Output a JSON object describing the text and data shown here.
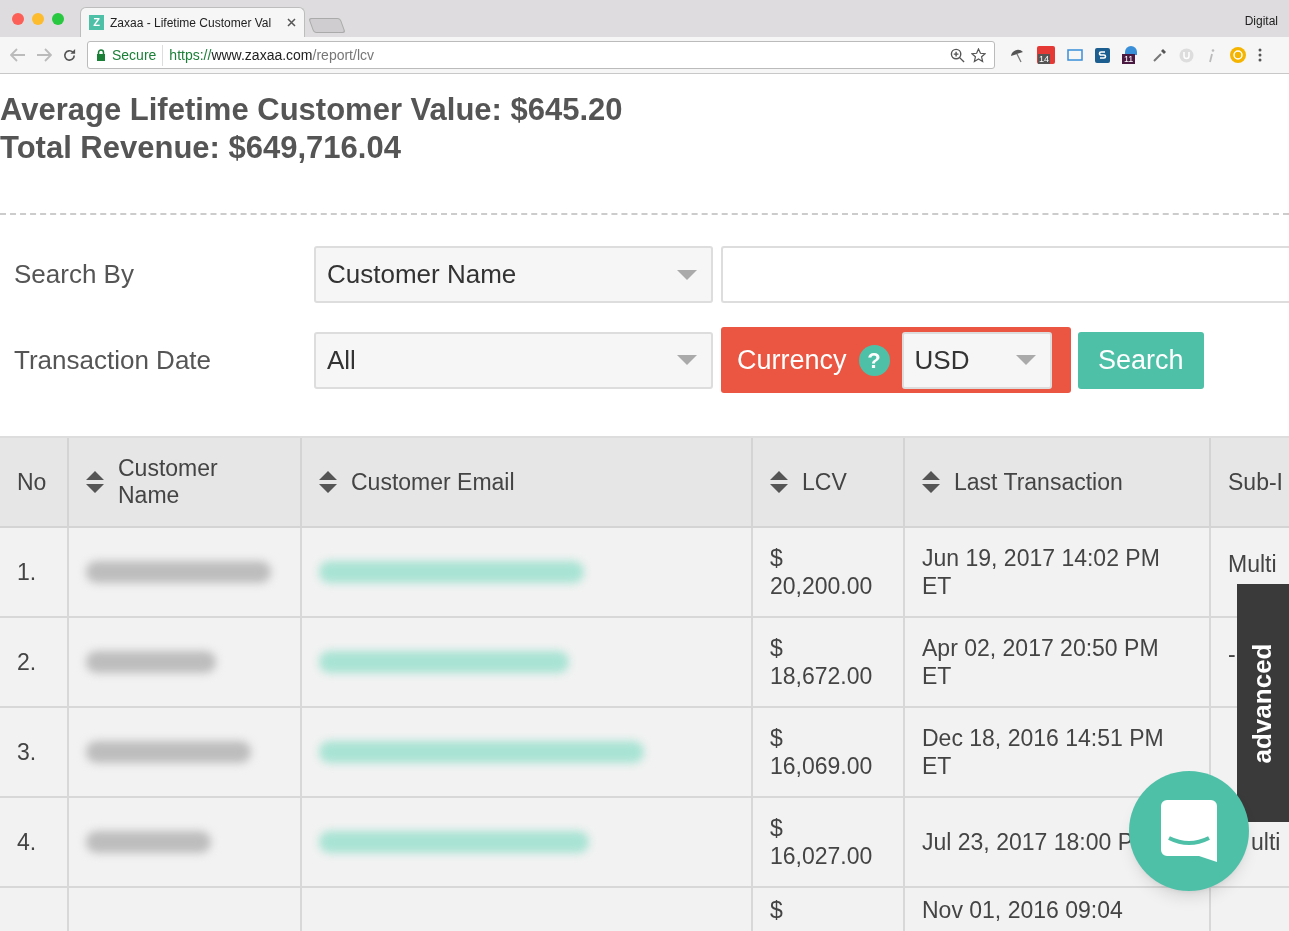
{
  "browser": {
    "tab_title": "Zaxaa - Lifetime Customer Val",
    "tab_favicon": "Z",
    "profile": "Digital",
    "secure_label": "Secure",
    "url_scheme": "https://",
    "url_host": "www.zaxaa.com",
    "url_path": "/report/lcv",
    "badges": [
      "14",
      "11"
    ]
  },
  "summary": {
    "average": "Average Lifetime Customer Value: $645.20",
    "total": "Total Revenue: $649,716.04"
  },
  "filters": {
    "search_by_label": "Search By",
    "search_by_value": "Customer Name",
    "transaction_date_label": "Transaction Date",
    "transaction_date_value": "All",
    "currency_label": "Currency",
    "currency_help": "?",
    "currency_value": "USD",
    "search_button": "Search"
  },
  "table": {
    "columns": [
      {
        "label": "No",
        "sortable": false
      },
      {
        "label": "Customer Name",
        "sortable": true
      },
      {
        "label": "Customer Email",
        "sortable": true
      },
      {
        "label": "LCV",
        "sortable": true
      },
      {
        "label": "Last Transaction",
        "sortable": true
      },
      {
        "label": "Sub-I",
        "sortable": false
      }
    ],
    "rows": [
      {
        "no": "1.",
        "lcv_symbol": "$",
        "lcv": "20,200.00",
        "last_transaction": "Jun 19, 2017 14:02 PM ET",
        "sub_id": "Multi"
      },
      {
        "no": "2.",
        "lcv_symbol": "$",
        "lcv": "18,672.00",
        "last_transaction": "Apr 02, 2017 20:50 PM ET",
        "sub_id": "-"
      },
      {
        "no": "3.",
        "lcv_symbol": "$",
        "lcv": "16,069.00",
        "last_transaction": "Dec 18, 2016 14:51 PM ET"
      },
      {
        "no": "4.",
        "lcv": "$ 16,027.00",
        "last_transaction": "Jul 23, 2017 18:00 P",
        "sub_id": "ulti"
      },
      {
        "lcv_symbol": "$",
        "last_transaction": "Nov 01, 2016 09:04"
      }
    ]
  },
  "advanced_tab": "advanced"
}
